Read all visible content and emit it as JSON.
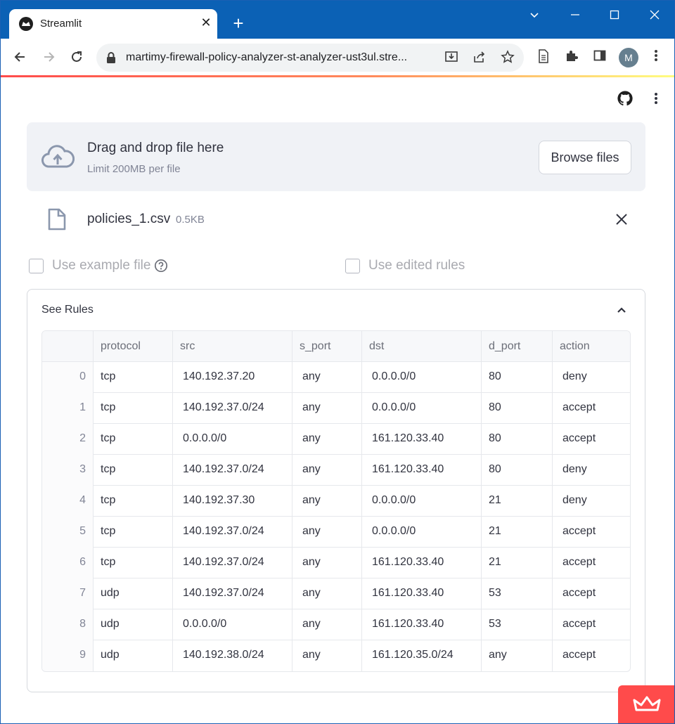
{
  "browser": {
    "tab_title": "Streamlit",
    "url": "martimy-firewall-policy-analyzer-st-analyzer-ust3ul.stre...",
    "profile_initial": "M"
  },
  "uploader": {
    "drop_title": "Drag and drop file here",
    "limit_text": "Limit 200MB per file",
    "browse_label": "Browse files"
  },
  "file": {
    "name": "policies_1.csv",
    "size": "0.5KB"
  },
  "options": {
    "example_label": "Use example file",
    "edited_label": "Use edited rules"
  },
  "expander": {
    "title": "See Rules"
  },
  "table": {
    "columns": [
      "",
      "protocol",
      "src",
      "s_port",
      "dst",
      "d_port",
      "action"
    ],
    "rows": [
      [
        "0",
        "tcp",
        "140.192.37.20",
        "any",
        "0.0.0.0/0",
        "80",
        "deny"
      ],
      [
        "1",
        "tcp",
        "140.192.37.0/24",
        "any",
        "0.0.0.0/0",
        "80",
        "accept"
      ],
      [
        "2",
        "tcp",
        "0.0.0.0/0",
        "any",
        "161.120.33.40",
        "80",
        "accept"
      ],
      [
        "3",
        "tcp",
        "140.192.37.0/24",
        "any",
        "161.120.33.40",
        "80",
        "deny"
      ],
      [
        "4",
        "tcp",
        "140.192.37.30",
        "any",
        "0.0.0.0/0",
        "21",
        "deny"
      ],
      [
        "5",
        "tcp",
        "140.192.37.0/24",
        "any",
        "0.0.0.0/0",
        "21",
        "accept"
      ],
      [
        "6",
        "tcp",
        "140.192.37.0/24",
        "any",
        "161.120.33.40",
        "21",
        "accept"
      ],
      [
        "7",
        "udp",
        "140.192.37.0/24",
        "any",
        "161.120.33.40",
        "53",
        "accept"
      ],
      [
        "8",
        "udp",
        "0.0.0.0/0",
        "any",
        "161.120.33.40",
        "53",
        "accept"
      ],
      [
        "9",
        "udp",
        "140.192.38.0/24",
        "any",
        "161.120.35.0/24",
        "any",
        "accept"
      ]
    ]
  },
  "colors": {
    "titlebar": "#0b61b5",
    "accent": "#ff4b4b",
    "text": "#31333f",
    "muted": "#808495"
  }
}
